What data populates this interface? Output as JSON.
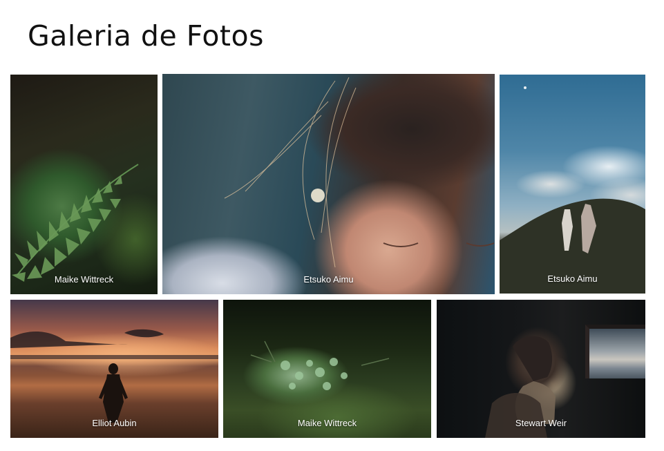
{
  "page": {
    "title": "Galeria de Fotos"
  },
  "photos": [
    {
      "author": "Maike Wittreck",
      "subject": "fern"
    },
    {
      "author": "Etsuko Aimu",
      "subject": "face"
    },
    {
      "author": "Etsuko Aimu",
      "subject": "sky-people"
    },
    {
      "author": "Elliot Aubin",
      "subject": "sunset-sea"
    },
    {
      "author": "Maike Wittreck",
      "subject": "moss"
    },
    {
      "author": "Stewart Weir",
      "subject": "window"
    }
  ],
  "colors": {
    "background": "#ffffff",
    "title": "#111111",
    "caption": "#ffffff"
  }
}
